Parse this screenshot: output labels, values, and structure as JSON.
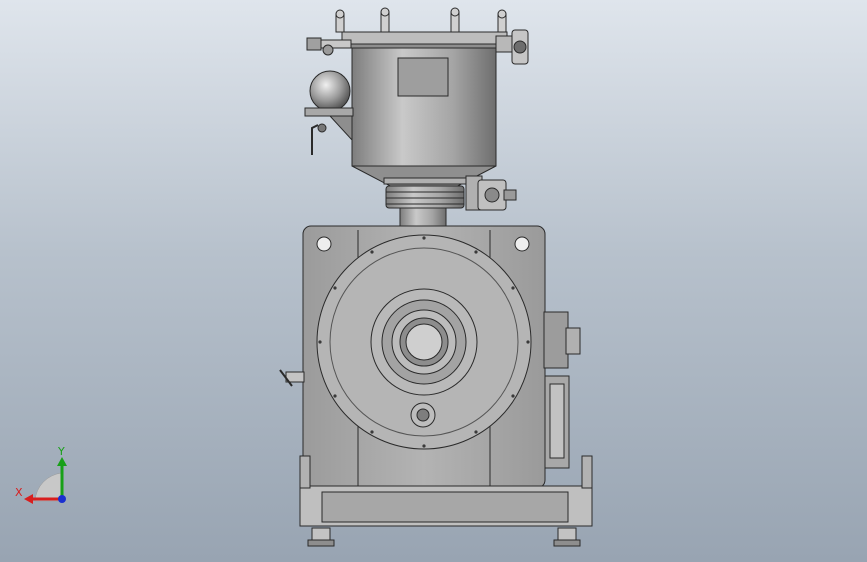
{
  "viewport": {
    "background_top": "#dfe5ec",
    "background_bottom": "#98a4b2"
  },
  "triad": {
    "x_label": "X",
    "y_label": "Y",
    "x_color": "#d81e1e",
    "y_color": "#18a018",
    "z_color": "#1a2fd0"
  },
  "model": {
    "body_fill": "#a8a8a8",
    "edge_color": "#2a2a2a",
    "light_fill": "#c8c8c8",
    "dark_fill": "#7c7c7c"
  }
}
